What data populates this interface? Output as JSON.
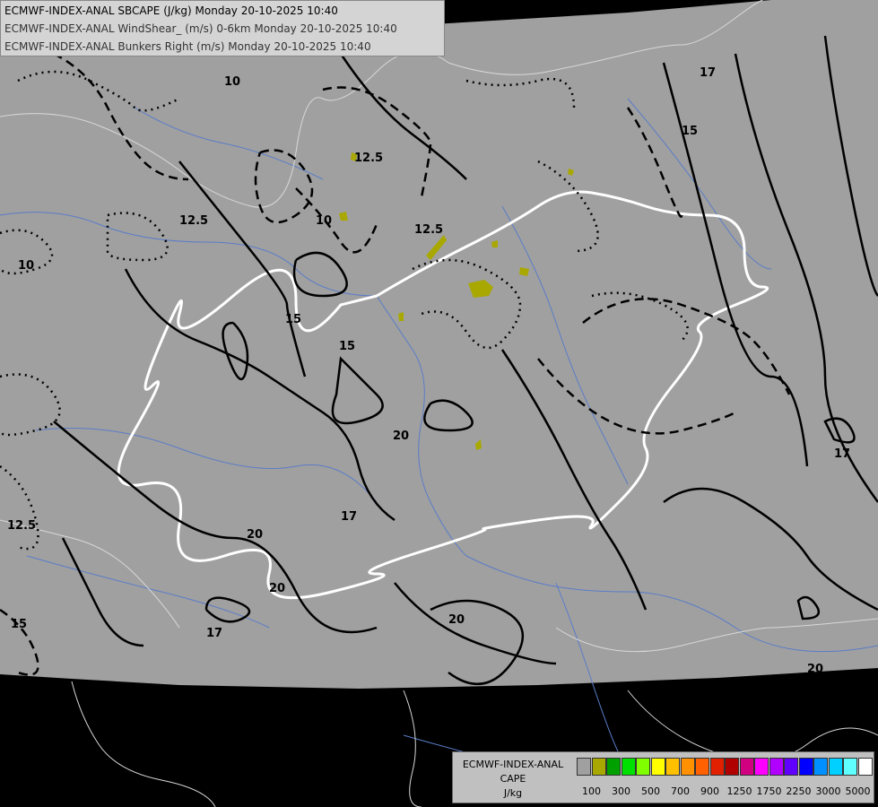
{
  "titles": {
    "line1": "ECMWF-INDEX-ANAL SBCAPE (J/kg) Monday 20-10-2025 10:40",
    "line2": "ECMWF-INDEX-ANAL WindShear_ (m/s) 0-6km Monday 20-10-2025 10:40",
    "line3": "ECMWF-INDEX-ANAL Bunkers Right (m/s) Monday 20-10-2025 10:40"
  },
  "legend": {
    "line1": "ECMWF-INDEX-ANAL",
    "line2": "CAPE",
    "line3": "J/kg",
    "swatches": [
      {
        "color": "#a0a0a0"
      },
      {
        "color": "#a8a800"
      },
      {
        "color": "#00a000"
      },
      {
        "color": "#00e000"
      },
      {
        "color": "#80ff00"
      },
      {
        "color": "#ffff00"
      },
      {
        "color": "#ffc000"
      },
      {
        "color": "#ff9000"
      },
      {
        "color": "#ff6000"
      },
      {
        "color": "#e02000"
      },
      {
        "color": "#b00000"
      },
      {
        "color": "#d00080"
      },
      {
        "color": "#ff00ff"
      },
      {
        "color": "#b000ff"
      },
      {
        "color": "#6000ff"
      },
      {
        "color": "#0000ff"
      },
      {
        "color": "#0090ff"
      },
      {
        "color": "#00d0ff"
      },
      {
        "color": "#60ffff"
      },
      {
        "color": "#ffffff"
      }
    ],
    "ticks": [
      "100",
      "300",
      "500",
      "700",
      "900",
      "1250",
      "1750",
      "2250",
      "3000",
      "5000"
    ]
  },
  "contour_labels": [
    "10",
    "12.5",
    "15",
    "17",
    "20"
  ],
  "colors": {
    "background": "#000000",
    "data_area": "#a0a0a0",
    "borders": "#ffffff",
    "rivers": "#5a7cc8",
    "contours": "#000000",
    "cape_low": "#a8a800"
  }
}
